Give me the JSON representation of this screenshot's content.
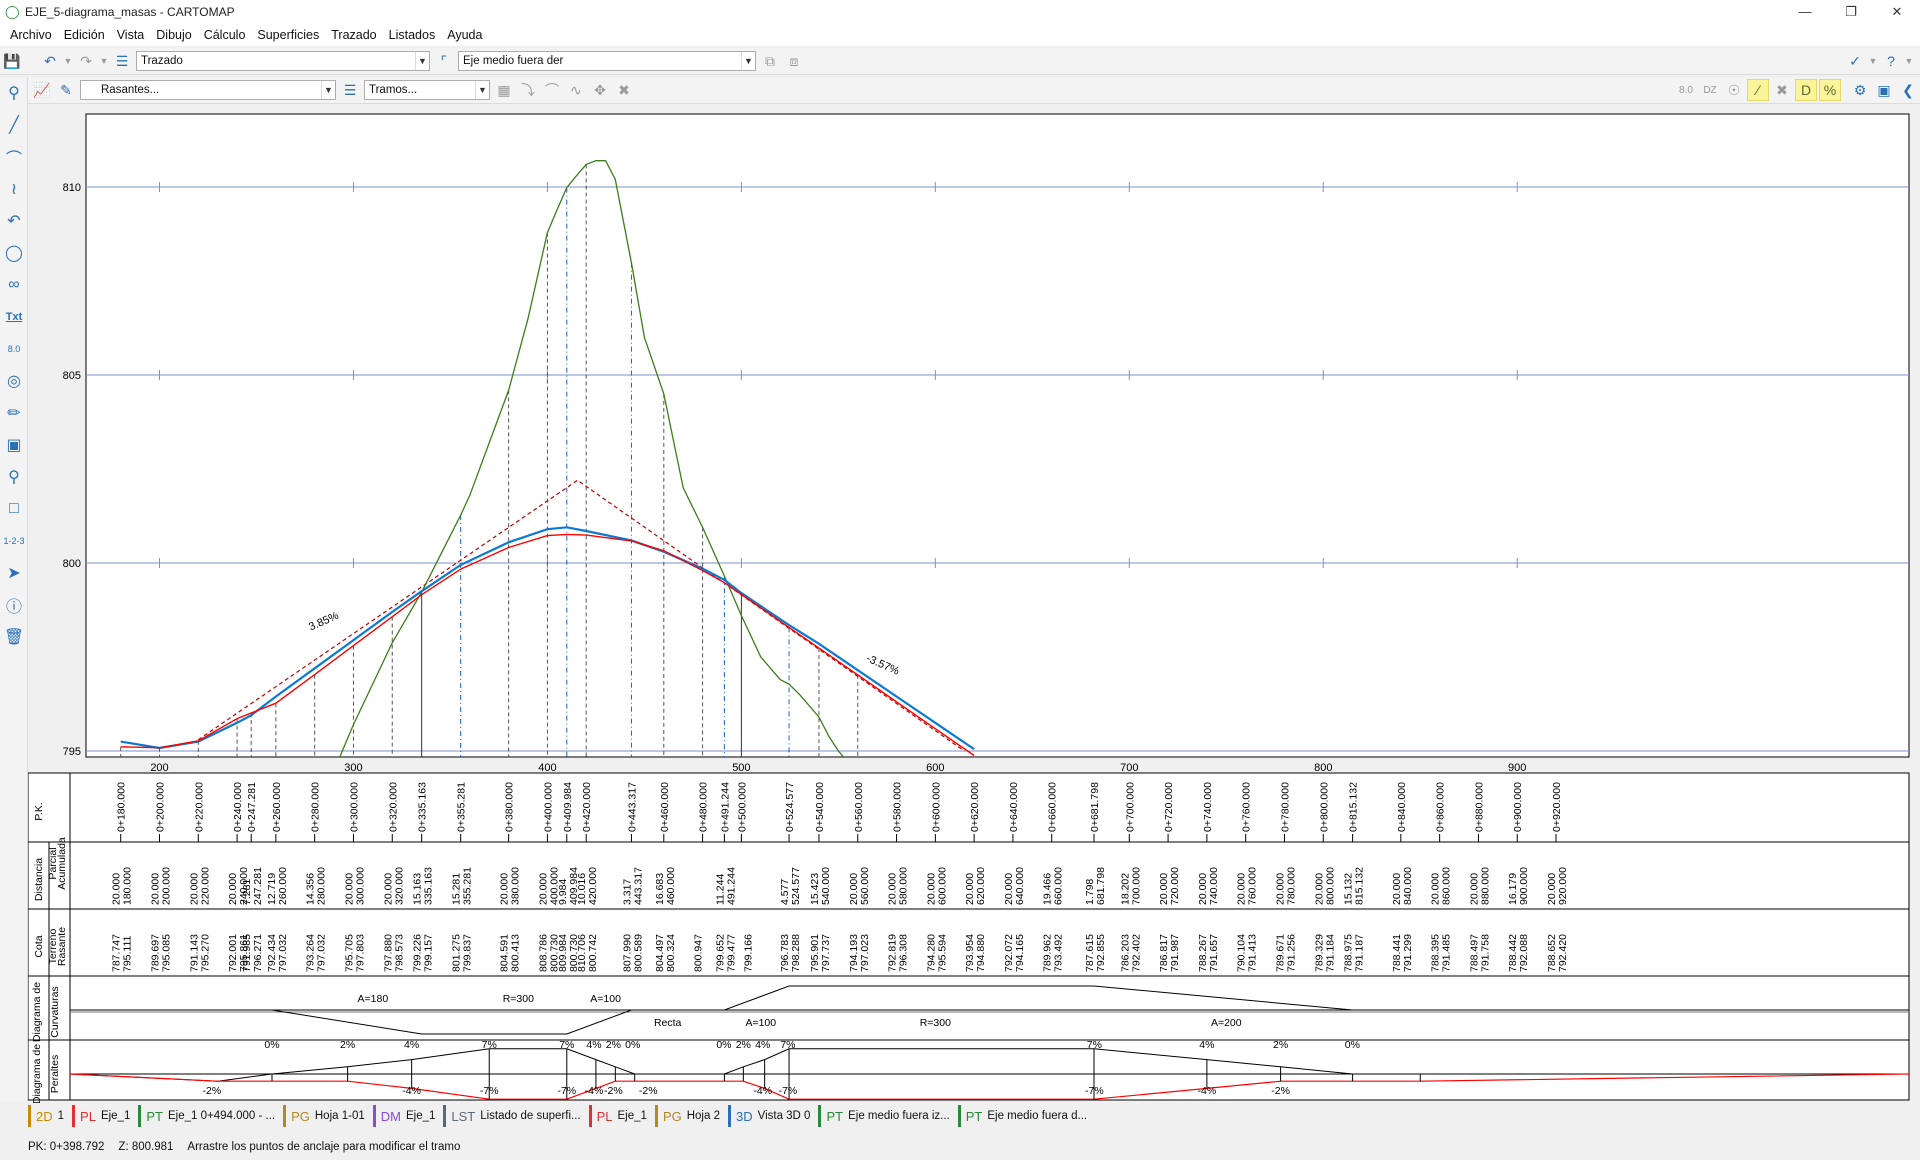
{
  "window": {
    "title": "EJE_5-diagrama_masas - CARTOMAP"
  },
  "menu": [
    "Archivo",
    "Edición",
    "Vista",
    "Dibujo",
    "Cálculo",
    "Superficies",
    "Trazado",
    "Listados",
    "Ayuda"
  ],
  "toolbar1": {
    "layer_combo": "Trazado",
    "axis_combo": "Eje medio fuera der"
  },
  "toolbar2": {
    "rasantes_combo": "Rasantes...",
    "tramos_combo": "Tramos..."
  },
  "sidebar_icons": [
    "zoom-icon",
    "line-icon",
    "arc-icon",
    "curve-radius-icon",
    "spiral-icon",
    "circle-icon",
    "infinity-icon",
    "text-icon",
    "dimension-icon",
    "target-icon",
    "ruler-icon",
    "image-icon",
    "pin-icon",
    "polygon-icon",
    "numbering-icon",
    "pointer-icon",
    "info-icon",
    "trash-icon"
  ],
  "colors": {
    "terrain": "#3b7e1a",
    "rasante": "#ff0000",
    "profile_blue": "#0a7ad4",
    "tangent_dashed": "#c00000",
    "grid": "#7f8fcf"
  },
  "chart_data": {
    "type": "line",
    "x_ticks": [
      200,
      300,
      400,
      500,
      600,
      700,
      800,
      900
    ],
    "y_ticks": [
      795,
      800,
      805,
      810
    ],
    "xlim": [
      180,
      933
    ],
    "ylim": [
      795,
      811
    ],
    "grid": "horizontal",
    "annotations": [
      {
        "text": "3.85%",
        "x": 278,
        "y": 798.2
      },
      {
        "text": "-3.57%",
        "x": 564,
        "y": 797.4
      }
    ],
    "series": [
      {
        "role": "terreno",
        "x": [
          180,
          200,
          220,
          240,
          247.281,
          260,
          280,
          300,
          320,
          335.163,
          355.281,
          360,
          380,
          390,
          400,
          405,
          409.984,
          415,
          420,
          425,
          430,
          435,
          443.317,
          450,
          460,
          470,
          480,
          491.244,
          500,
          510,
          520,
          524.577,
          530,
          540,
          545,
          550,
          555,
          560
        ],
        "y": [
          787.747,
          789.697,
          791.143,
          792.001,
          791.985,
          792.434,
          793.264,
          795.705,
          797.88,
          799.226,
          801.275,
          801.8,
          804.591,
          806.5,
          808.786,
          809.4,
          809.984,
          810.3,
          810.6,
          810.7,
          810.7,
          810.2,
          807.99,
          806.0,
          804.497,
          802.0,
          800.947,
          799.652,
          798.6,
          797.5,
          796.9,
          796.783,
          796.5,
          795.901,
          795.4,
          795.0,
          794.7,
          794.193
        ]
      },
      {
        "role": "rasante",
        "x": [
          180,
          200,
          220,
          240,
          260,
          280,
          300,
          320,
          335.163,
          355.281,
          380,
          400,
          409.984,
          420,
          443.317,
          460,
          480,
          491.244,
          500,
          524.577,
          540,
          560,
          580,
          600,
          620
        ],
        "y": [
          795.111,
          795.085,
          795.27,
          795.861,
          796.271,
          797.032,
          797.803,
          798.573,
          799.157,
          799.837,
          800.413,
          800.73,
          800.76,
          800.742,
          800.589,
          800.324,
          799.8,
          799.477,
          799.166,
          798.288,
          797.737,
          797.023,
          796.308,
          795.594,
          794.88
        ]
      },
      {
        "role": "eje",
        "x": [
          180,
          200,
          220,
          240,
          247.281,
          260,
          280,
          300,
          320,
          335.163,
          355.281,
          380,
          400,
          409.984,
          420,
          443.317,
          460,
          480,
          491.244,
          500,
          524.577,
          540,
          560,
          580,
          600,
          620
        ],
        "y": [
          795.25,
          795.08,
          795.25,
          795.75,
          795.95,
          796.45,
          797.2,
          797.95,
          798.7,
          799.25,
          799.95,
          800.55,
          800.9,
          800.95,
          800.85,
          800.6,
          800.3,
          799.85,
          799.55,
          799.2,
          798.35,
          797.85,
          797.15,
          796.45,
          795.75,
          795.05
        ]
      },
      {
        "role": "tangentes",
        "x": [
          220,
          415.5,
          615
        ],
        "y": [
          795.3,
          802.2,
          795.0
        ]
      }
    ],
    "table": {
      "row_labels": [
        "P.K.",
        "Distancia",
        "Parcial",
        "Acumulada",
        "Cota",
        "Terreno",
        "Rasante",
        "Diagrama de",
        "Curvaturas",
        "Diagrama de",
        "Peraltes"
      ],
      "stations": [
        {
          "x": 180,
          "pk": "0+180.000",
          "parcial": "20.000",
          "acumulada": "180.000",
          "terreno": "787.747",
          "rasante": "795.111"
        },
        {
          "x": 200,
          "pk": "0+200.000",
          "parcial": "20.000",
          "acumulada": "200.000",
          "terreno": "789.697",
          "rasante": "795.085"
        },
        {
          "x": 220,
          "pk": "0+220.000",
          "parcial": "20.000",
          "acumulada": "220.000",
          "terreno": "791.143",
          "rasante": "795.270"
        },
        {
          "x": 240,
          "pk": "0+240.000",
          "parcial": "20.000",
          "acumulada": "240.000",
          "terreno": "792.001",
          "rasante": "795.861"
        },
        {
          "x": 247.281,
          "pk": "0+247.281",
          "parcial": "7.281",
          "acumulada": "247.281",
          "terreno": "791.985",
          "rasante": "796.271"
        },
        {
          "x": 260,
          "pk": "0+260.000",
          "parcial": "12.719",
          "acumulada": "260.000",
          "terreno": "792.434",
          "rasante": "797.032"
        },
        {
          "x": 280,
          "pk": "0+280.000",
          "parcial": "14.356",
          "acumulada": "280.000",
          "terreno": "793.264",
          "rasante": "797.032"
        },
        {
          "x": 300,
          "pk": "0+300.000",
          "parcial": "20.000",
          "acumulada": "300.000",
          "terreno": "795.705",
          "rasante": "797.803"
        },
        {
          "x": 320,
          "pk": "0+320.000",
          "parcial": "20.000",
          "acumulada": "320.000",
          "terreno": "797.880",
          "rasante": "798.573"
        },
        {
          "x": 335.163,
          "pk": "0+335.163",
          "parcial": "15.163",
          "acumulada": "335.163",
          "terreno": "799.226",
          "rasante": "799.157"
        },
        {
          "x": 355.281,
          "pk": "0+355.281",
          "parcial": "15.281",
          "acumulada": "355.281",
          "terreno": "801.275",
          "rasante": "799.837"
        },
        {
          "x": 380,
          "pk": "0+380.000",
          "parcial": "20.000",
          "acumulada": "380.000",
          "terreno": "804.591",
          "rasante": "800.413"
        },
        {
          "x": 400,
          "pk": "0+400.000",
          "parcial": "20.000",
          "acumulada": "400.000",
          "terreno": "808.786",
          "rasante": "800.730"
        },
        {
          "x": 409.984,
          "pk": "0+409.984",
          "parcial": "9.984",
          "acumulada": "409.984",
          "terreno": "809.984",
          "rasante": "800.730"
        },
        {
          "x": 420,
          "pk": "0+420.000",
          "parcial": "10.016",
          "acumulada": "420.000",
          "terreno": "810.706",
          "rasante": "800.742"
        },
        {
          "x": 443.317,
          "pk": "0+443.317",
          "parcial": "3.317",
          "acumulada": "443.317",
          "terreno": "807.990",
          "rasante": "800.589"
        },
        {
          "x": 460,
          "pk": "0+460.000",
          "parcial": "16.683",
          "acumulada": "460.000",
          "terreno": "804.497",
          "rasante": "800.324"
        },
        {
          "x": 480,
          "pk": "0+480.000",
          "parcial": "",
          "acumulada": "",
          "terreno": "800.947",
          "rasante": ""
        },
        {
          "x": 491.244,
          "pk": "0+491.244",
          "parcial": "11.244",
          "acumulada": "491.244",
          "terreno": "799.652",
          "rasante": "799.477"
        },
        {
          "x": 500,
          "pk": "0+500.000",
          "parcial": "",
          "acumulada": "",
          "terreno": "",
          "rasante": "799.166"
        },
        {
          "x": 524.577,
          "pk": "0+524.577",
          "parcial": "4.577",
          "acumulada": "524.577",
          "terreno": "796.783",
          "rasante": "798.288"
        },
        {
          "x": 540,
          "pk": "0+540.000",
          "parcial": "15.423",
          "acumulada": "540.000",
          "terreno": "795.901",
          "rasante": "797.737"
        },
        {
          "x": 560,
          "pk": "0+560.000",
          "parcial": "20.000",
          "acumulada": "560.000",
          "terreno": "794.193",
          "rasante": "797.023"
        },
        {
          "x": 580,
          "pk": "0+580.000",
          "parcial": "20.000",
          "acumulada": "580.000",
          "terreno": "792.819",
          "rasante": "796.308"
        },
        {
          "x": 600,
          "pk": "0+600.000",
          "parcial": "20.000",
          "acumulada": "600.000",
          "terreno": "794.280",
          "rasante": "795.594"
        },
        {
          "x": 620,
          "pk": "0+620.000",
          "parcial": "20.000",
          "acumulada": "620.000",
          "terreno": "793.954",
          "rasante": "794.880"
        },
        {
          "x": 640,
          "pk": "0+640.000",
          "parcial": "20.000",
          "acumulada": "640.000",
          "terreno": "792.072",
          "rasante": "794.165"
        },
        {
          "x": 660,
          "pk": "0+660.000",
          "parcial": "19.466",
          "acumulada": "660.000",
          "terreno": "789.962",
          "rasante": "793.492"
        },
        {
          "x": 681.798,
          "pk": "0+681.798",
          "parcial": "1.798",
          "acumulada": "681.798",
          "terreno": "787.615",
          "rasante": "792.855"
        },
        {
          "x": 700,
          "pk": "0+700.000",
          "parcial": "18.202",
          "acumulada": "700.000",
          "terreno": "786.203",
          "rasante": "792.402"
        },
        {
          "x": 720,
          "pk": "0+720.000",
          "parcial": "20.000",
          "acumulada": "720.000",
          "terreno": "786.817",
          "rasante": "791.987"
        },
        {
          "x": 740,
          "pk": "0+740.000",
          "parcial": "20.000",
          "acumulada": "740.000",
          "terreno": "788.267",
          "rasante": "791.657"
        },
        {
          "x": 760,
          "pk": "0+760.000",
          "parcial": "20.000",
          "acumulada": "760.000",
          "terreno": "790.104",
          "rasante": "791.413"
        },
        {
          "x": 780,
          "pk": "0+780.000",
          "parcial": "20.000",
          "acumulada": "780.000",
          "terreno": "789.671",
          "rasante": "791.256"
        },
        {
          "x": 800,
          "pk": "0+800.000",
          "parcial": "20.000",
          "acumulada": "800.000",
          "terreno": "789.329",
          "rasante": "791.184"
        },
        {
          "x": 815.132,
          "pk": "0+815.132",
          "parcial": "15.132",
          "acumulada": "815.132",
          "terreno": "788.975",
          "rasante": "791.187"
        },
        {
          "x": 840,
          "pk": "0+840.000",
          "parcial": "20.000",
          "acumulada": "840.000",
          "terreno": "788.441",
          "rasante": "791.299"
        },
        {
          "x": 860,
          "pk": "0+860.000",
          "parcial": "20.000",
          "acumulada": "860.000",
          "terreno": "788.395",
          "rasante": "791.485"
        },
        {
          "x": 880,
          "pk": "0+880.000",
          "parcial": "20.000",
          "acumulada": "880.000",
          "terreno": "788.497",
          "rasante": "791.758"
        },
        {
          "x": 900,
          "pk": "0+900.000",
          "parcial": "16.179",
          "acumulada": "900.000",
          "terreno": "788.442",
          "rasante": "792.088"
        },
        {
          "x": 920,
          "pk": "0+920.000",
          "parcial": "20.000",
          "acumulada": "920.000",
          "terreno": "788.652",
          "rasante": "792.420"
        }
      ],
      "curvature": {
        "labels": [
          {
            "x": 310,
            "text": "A=180",
            "pos": "top"
          },
          {
            "x": 385,
            "text": "R=300",
            "pos": "top"
          },
          {
            "x": 430,
            "text": "A=100",
            "pos": "top"
          },
          {
            "x": 462,
            "text": "Recta",
            "pos": "bottom"
          },
          {
            "x": 510,
            "text": "A=100",
            "pos": "bottom"
          },
          {
            "x": 600,
            "text": "R=300",
            "pos": "bottom"
          },
          {
            "x": 750,
            "text": "A=200",
            "pos": "bottom"
          }
        ],
        "line_x": [
          180,
          258,
          335.163,
          409.984,
          443.317,
          491.244,
          524.577,
          681.798,
          815.132,
          933
        ],
        "line_v": [
          0,
          0,
          -1,
          -1,
          0,
          0,
          1,
          1,
          0,
          0
        ]
      },
      "peraltes": {
        "left_x": [
          230,
          258,
          297,
          330,
          370,
          409.984,
          425,
          435,
          445,
          491.244,
          501,
          512,
          524.577,
          681.798,
          740,
          778,
          815.132,
          850
        ],
        "left_v": [
          -2,
          0,
          2,
          4,
          7,
          7,
          4,
          2,
          0,
          0,
          2,
          4,
          7,
          7,
          4,
          2,
          0,
          0
        ],
        "right_v": [
          -2,
          -2,
          -2,
          -4,
          -7,
          -7,
          -4,
          -2,
          -2,
          -2,
          -2,
          -4,
          -7,
          -7,
          -4,
          -2,
          -2,
          -2
        ],
        "labels": [
          {
            "x": 227,
            "text": "-2%",
            "pos": "below"
          },
          {
            "x": 258,
            "text": "0%",
            "pos": "above"
          },
          {
            "x": 297,
            "text": "2%",
            "pos": "above"
          },
          {
            "x": 330,
            "text": "4%",
            "pos": "above"
          },
          {
            "x": 330,
            "text": "-4%",
            "pos": "below"
          },
          {
            "x": 370,
            "text": "7%",
            "pos": "above"
          },
          {
            "x": 370,
            "text": "-7%",
            "pos": "below"
          },
          {
            "x": 410,
            "text": "7%",
            "pos": "above"
          },
          {
            "x": 410,
            "text": "-7%",
            "pos": "below"
          },
          {
            "x": 424,
            "text": "4%",
            "pos": "above"
          },
          {
            "x": 424,
            "text": "-4%",
            "pos": "below"
          },
          {
            "x": 434,
            "text": "2%",
            "pos": "above"
          },
          {
            "x": 434,
            "text": "-2%",
            "pos": "below"
          },
          {
            "x": 444,
            "text": "0%",
            "pos": "above"
          },
          {
            "x": 452,
            "text": "-2%",
            "pos": "below"
          },
          {
            "x": 491,
            "text": "0%",
            "pos": "above"
          },
          {
            "x": 501,
            "text": "2%",
            "pos": "above"
          },
          {
            "x": 511,
            "text": "4%",
            "pos": "above"
          },
          {
            "x": 511,
            "text": "-4%",
            "pos": "below"
          },
          {
            "x": 524,
            "text": "7%",
            "pos": "above"
          },
          {
            "x": 524,
            "text": "-7%",
            "pos": "below"
          },
          {
            "x": 682,
            "text": "7%",
            "pos": "above"
          },
          {
            "x": 682,
            "text": "-7%",
            "pos": "below"
          },
          {
            "x": 740,
            "text": "4%",
            "pos": "above"
          },
          {
            "x": 740,
            "text": "-4%",
            "pos": "below"
          },
          {
            "x": 778,
            "text": "2%",
            "pos": "above"
          },
          {
            "x": 778,
            "text": "-2%",
            "pos": "below"
          },
          {
            "x": 815,
            "text": "0%",
            "pos": "above"
          }
        ]
      }
    }
  },
  "tabs": [
    {
      "prefix": "2D",
      "label": "1",
      "color": "#c98a00"
    },
    {
      "prefix": "PL",
      "label": "Eje_1",
      "color": "#e03030"
    },
    {
      "prefix": "PT",
      "label": "Eje_1 0+494.000 - ...",
      "color": "#2a8a3a"
    },
    {
      "prefix": "PG",
      "label": "Hoja 1-01",
      "color": "#b08a2a"
    },
    {
      "prefix": "DM",
      "label": "Eje_1",
      "color": "#8a4ae0"
    },
    {
      "prefix": "LST",
      "label": "Listado de superfi...",
      "color": "#5a6a7a"
    },
    {
      "prefix": "PL",
      "label": "Eje_1",
      "color": "#e03030"
    },
    {
      "prefix": "PG",
      "label": "Hoja 2",
      "color": "#b08a2a"
    },
    {
      "prefix": "3D",
      "label": "Vista 3D 0",
      "color": "#2a6fb8"
    },
    {
      "prefix": "PT",
      "label": "Eje medio fuera iz...",
      "color": "#2a8a3a"
    },
    {
      "prefix": "PT",
      "label": "Eje medio fuera d...",
      "color": "#2a8a3a"
    }
  ],
  "status": {
    "pk": "PK:  0+398.792",
    "z": "Z:  800.981",
    "message": "Arrastre los puntos de anclaje para modificar el tramo"
  }
}
